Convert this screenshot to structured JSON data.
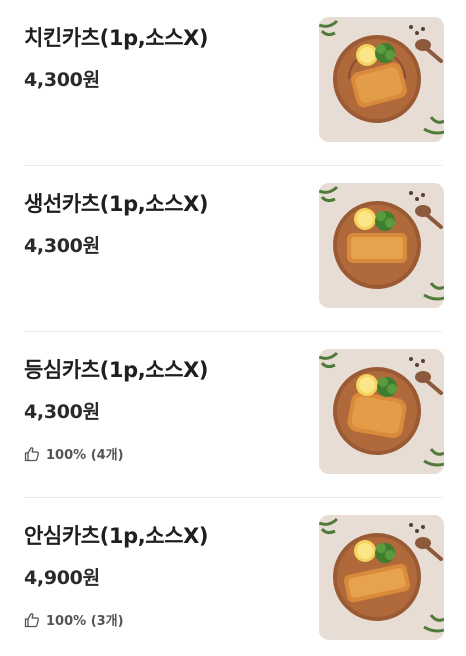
{
  "menu": {
    "items": [
      {
        "name": "치킨카츠(1p,소스X)",
        "price": "4,300원",
        "rating": ""
      },
      {
        "name": "생선카츠(1p,소스X)",
        "price": "4,300원",
        "rating": ""
      },
      {
        "name": "등심카츠(1p,소스X)",
        "price": "4,300원",
        "rating": "100% (4개)"
      },
      {
        "name": "안심카츠(1p,소스X)",
        "price": "4,900원",
        "rating": "100% (3개)"
      }
    ]
  },
  "icons": {
    "rating": "thumbs-up-icon"
  },
  "colors": {
    "text_primary": "#1f1f1f",
    "text_secondary": "#555555",
    "divider": "#eaeaea",
    "photo_background": "#e7ddd6"
  }
}
